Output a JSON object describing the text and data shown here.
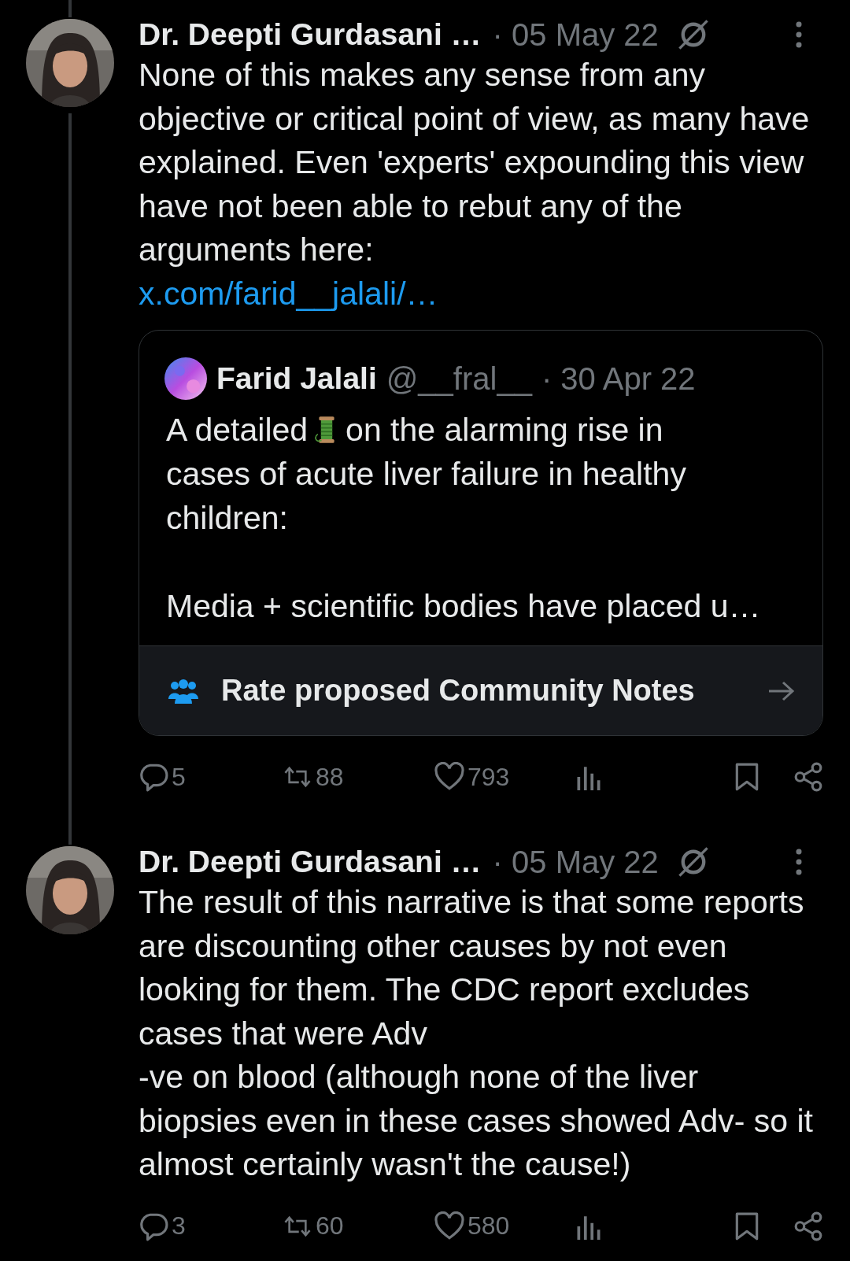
{
  "tweets": [
    {
      "author": "Dr. Deepti Gurdasani …",
      "date": "· 05 May 22",
      "text": "None of this makes any sense from any objective or critical point of view, as many have explained. Even 'experts' expounding this view have not been able to rebut any of the arguments here:",
      "link": "x.com/farid__jalali/…",
      "quote": {
        "author": "Farid Jalali",
        "handle": "@__fral__",
        "date": "· 30 Apr 22",
        "text_before": "A detailed",
        "text_after": "on the alarming rise in",
        "text_rest": "cases of acute liver failure in healthy children:\n\nMedia + scientific bodies have placed u…",
        "notes": "Rate proposed Community Notes"
      },
      "stats": {
        "replies": "5",
        "reposts": "88",
        "likes": "793"
      }
    },
    {
      "author": "Dr. Deepti Gurdasani …",
      "date": "· 05 May 22",
      "text": "The result of this narrative is that some reports are discounting other causes by not even looking for them. The CDC report excludes cases that were Adv\n-ve on blood (although none of the liver biopsies even in these cases showed Adv- so it almost certainly wasn't the cause!)",
      "stats": {
        "replies": "3",
        "reposts": "60",
        "likes": "580"
      }
    }
  ]
}
